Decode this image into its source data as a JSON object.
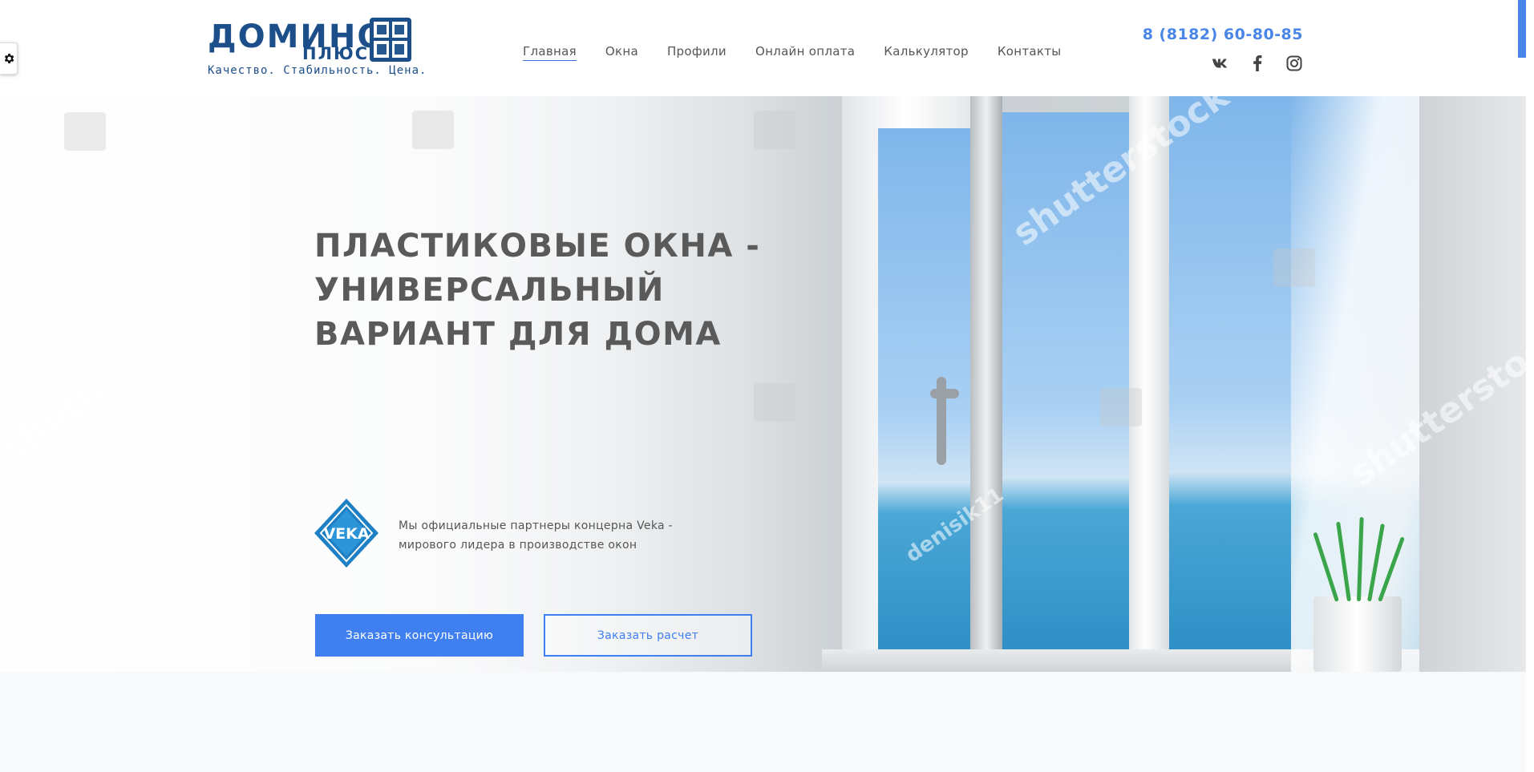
{
  "logo": {
    "word": "ДОМИНО",
    "sub": "ПЛЮС",
    "tagline": "Качество. Стабильность. Цена.",
    "color": "#1c4f8a"
  },
  "nav": {
    "items": [
      {
        "label": "Главная",
        "active": true
      },
      {
        "label": "Окна"
      },
      {
        "label": "Профили"
      },
      {
        "label": "Онлайн оплата"
      },
      {
        "label": "Калькулятор"
      },
      {
        "label": "Контакты"
      }
    ]
  },
  "contact": {
    "phone": "8 (8182) 60-80-85",
    "socials": [
      "vk-icon",
      "facebook-icon",
      "instagram-icon"
    ]
  },
  "hero": {
    "title_lines": [
      "ПЛАСТИКОВЫЕ ОКНА -",
      "УНИВЕРСАЛЬНЫЙ",
      "ВАРИАНТ ДЛЯ ДОМА"
    ],
    "partner_logo": "VEKA",
    "partner_line1": "Мы официальные партнеры концерна Veka -",
    "partner_line2": "мирового лидера в производстве окон",
    "btn_consult": "Заказать консультацию",
    "btn_calc": "Заказать расчет",
    "watermarks": [
      "shutterstock",
      "shutterstock",
      "shutterstock",
      "denisik11"
    ]
  },
  "colors": {
    "accent": "#3f7fef",
    "phone": "#4a86e8",
    "title": "#5a5a5a"
  }
}
